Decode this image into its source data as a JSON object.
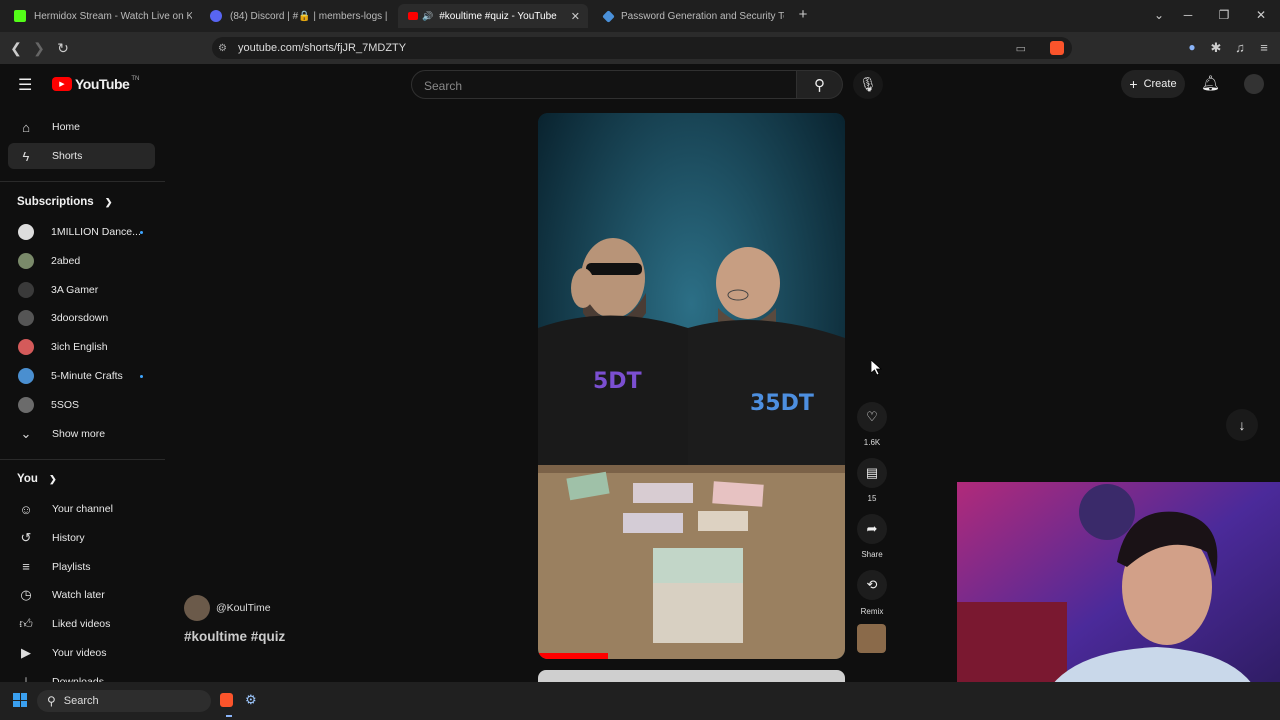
{
  "browser": {
    "tabs": [
      {
        "title": "Hermidox Stream - Watch Live on Ki",
        "favicon_color": "#53fc18"
      },
      {
        "title": "(84) Discord | #🔒 | members-logs |",
        "favicon_color": "#5865f2"
      },
      {
        "title": "#koultime #quiz - YouTube",
        "favicon_color": "#ff0000"
      },
      {
        "title": "Password Generation and Security Te",
        "favicon_color": "#4a90d9"
      }
    ],
    "url": "youtube.com/shorts/fjJR_7MDZTY"
  },
  "youtube": {
    "logo_text": "YouTube",
    "logo_sup": "TN",
    "search_placeholder": "Search",
    "create_label": "Create"
  },
  "sidebar": {
    "home": "Home",
    "shorts": "Shorts",
    "subscriptions_header": "Subscriptions",
    "subscriptions": [
      {
        "name": "1MILLION Dance...",
        "color": "#dddddd",
        "live": true
      },
      {
        "name": "2abed",
        "color": "#7a8a6a",
        "live": false
      },
      {
        "name": "3A Gamer",
        "color": "#3a3a3a",
        "live": false
      },
      {
        "name": "3doorsdown",
        "color": "#555555",
        "live": false
      },
      {
        "name": "3ich English",
        "color": "#d45a5a",
        "live": false
      },
      {
        "name": "5-Minute Crafts",
        "color": "#4a8fd0",
        "live": true
      },
      {
        "name": "5SOS",
        "color": "#6b6b6b",
        "live": false
      }
    ],
    "show_more": "Show more",
    "you_header": "You",
    "you_items": [
      {
        "label": "Your channel",
        "icon": "person-icon"
      },
      {
        "label": "History",
        "icon": "history-icon"
      },
      {
        "label": "Playlists",
        "icon": "playlist-icon"
      },
      {
        "label": "Watch later",
        "icon": "clock-icon"
      },
      {
        "label": "Liked videos",
        "icon": "thumb-up-icon"
      },
      {
        "label": "Your videos",
        "icon": "video-icon"
      },
      {
        "label": "Downloads",
        "icon": "download-icon"
      }
    ]
  },
  "short": {
    "channel": "@KoulTime",
    "title": "#koultime #quiz",
    "likes": "1.6K",
    "comments": "15",
    "share_label": "Share",
    "remix_label": "Remix"
  },
  "taskbar": {
    "search_label": "Search"
  }
}
